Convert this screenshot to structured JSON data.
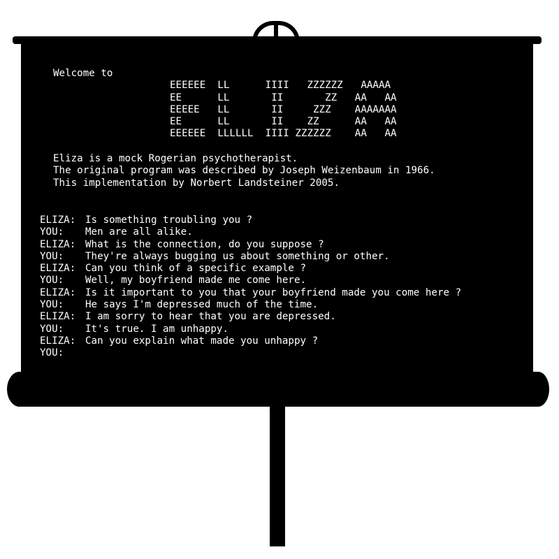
{
  "banner": {
    "welcome": "Welcome to",
    "art": [
      "EEEEEE  LL      IIII   ZZZZZZ   AAAAA",
      "EE      LL       II       ZZ   AA   AA",
      "EEEEE   LL       II     ZZZ    AAAAAAA",
      "EE      LL       II    ZZ      AA   AA",
      "EEEEEE  LLLLLL  IIII ZZZZZZ    AA   AA"
    ]
  },
  "about": [
    "Eliza is a mock Rogerian psychotherapist.",
    "The original program was described by Joseph Weizenbaum in 1966.",
    "This implementation by Norbert Landsteiner 2005."
  ],
  "transcript": [
    {
      "speaker": "ELIZA:",
      "text": "Is something troubling you ?"
    },
    {
      "speaker": "YOU:",
      "text": "Men are all alike."
    },
    {
      "speaker": "ELIZA:",
      "text": "What is the connection, do you suppose ?"
    },
    {
      "speaker": "YOU:",
      "text": "They're always bugging us about something or other."
    },
    {
      "speaker": "ELIZA:",
      "text": "Can you think of a specific example ?"
    },
    {
      "speaker": "YOU:",
      "text": "Well, my boyfriend made me come here."
    },
    {
      "speaker": "ELIZA:",
      "text": "Is it important to you that your boyfriend made you come here ?"
    },
    {
      "speaker": "YOU:",
      "text": "He says I'm depressed much of the time."
    },
    {
      "speaker": "ELIZA:",
      "text": "I am sorry to hear that you are depressed."
    },
    {
      "speaker": "YOU:",
      "text": "It's true. I am unhappy."
    },
    {
      "speaker": "ELIZA:",
      "text": "Can you explain what made you unhappy ?"
    }
  ],
  "prompt": {
    "speaker": "YOU:",
    "input_value": ""
  }
}
